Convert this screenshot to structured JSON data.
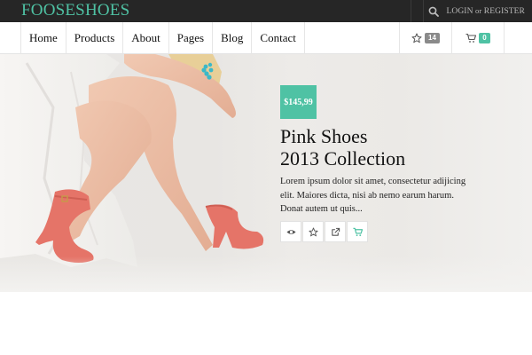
{
  "brand": {
    "logo_text": "FOOSESHOES",
    "accent": "#4fc2a4"
  },
  "topbar": {
    "login_label": "LOGIN",
    "or_label": "or",
    "register_label": "REGISTER",
    "search_icon": "search-icon"
  },
  "nav": {
    "items": [
      {
        "label": "Home"
      },
      {
        "label": "Products"
      },
      {
        "label": "About"
      },
      {
        "label": "Pages"
      },
      {
        "label": "Blog"
      },
      {
        "label": "Contact"
      }
    ],
    "wishlist": {
      "icon": "star-icon",
      "count": "14"
    },
    "cart": {
      "icon": "cart-icon",
      "count": "0"
    }
  },
  "hero": {
    "price": "$145,99",
    "title_line1": "Pink Shoes",
    "title_line2": "2013 Collection",
    "description": "Lorem ipsum dolor sit amet, consectetur adijicing elit. Maiores dicta, nisi ab nemo earum harum. Donat autem ut quis...",
    "actions": [
      {
        "icon": "eye-icon"
      },
      {
        "icon": "star-icon"
      },
      {
        "icon": "external-link-icon"
      },
      {
        "icon": "cart-icon"
      }
    ]
  }
}
